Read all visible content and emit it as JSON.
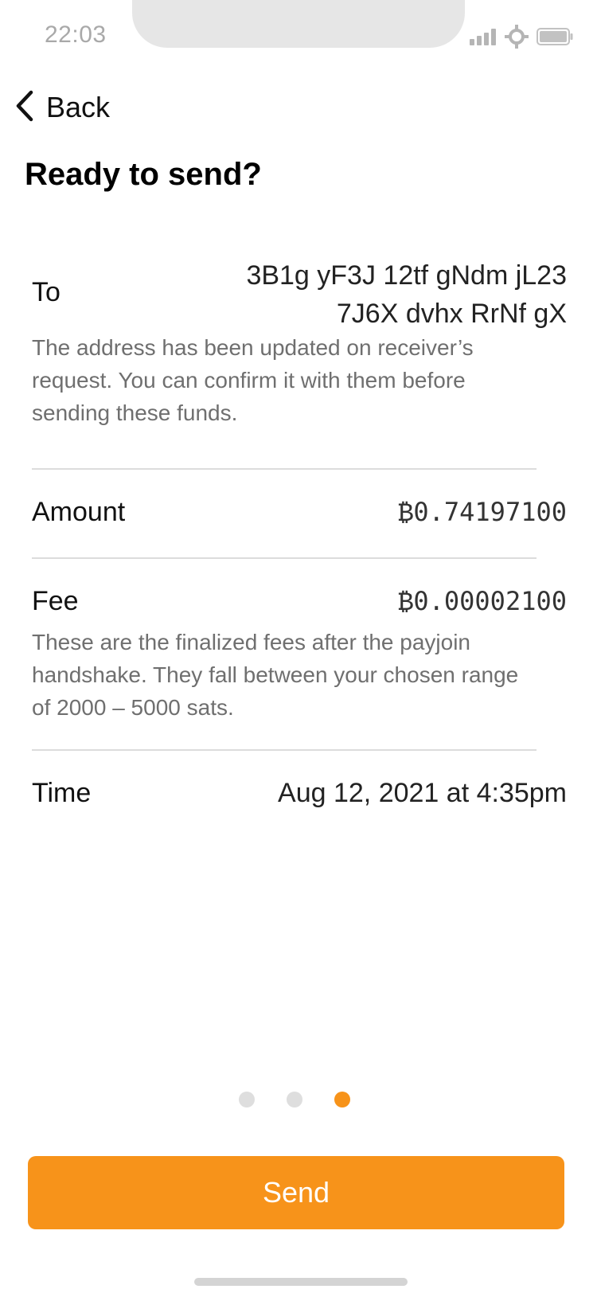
{
  "status_bar": {
    "time": "22:03",
    "icons": [
      "signal-icon",
      "crosshair-icon",
      "battery-icon"
    ]
  },
  "nav": {
    "back_label": "Back",
    "back_icon": "chevron-left-icon"
  },
  "title": "Ready to send?",
  "details": {
    "to": {
      "label": "To",
      "address_line1": "3B1g yF3J 12tf gNdm jL23",
      "address_line2": "7J6X dvhx RrNf gX",
      "note": "The address has been updated on receiver’s request. You can confirm it with them before sending these funds."
    },
    "amount": {
      "label": "Amount",
      "value": "₿0.74197100"
    },
    "fee": {
      "label": "Fee",
      "value": "₿0.00002100",
      "note": "These are the finalized fees after the payjoin handshake. They fall between your chosen range of 2000 – 5000 sats."
    },
    "time": {
      "label": "Time",
      "value": "Aug 12, 2021 at 4:35pm"
    }
  },
  "pagination": {
    "total": 3,
    "current": 3
  },
  "send_button": {
    "label": "Send"
  },
  "colors": {
    "accent": "#f7931a",
    "muted_text": "#6f6f6f",
    "divider": "#dcdcdc"
  }
}
